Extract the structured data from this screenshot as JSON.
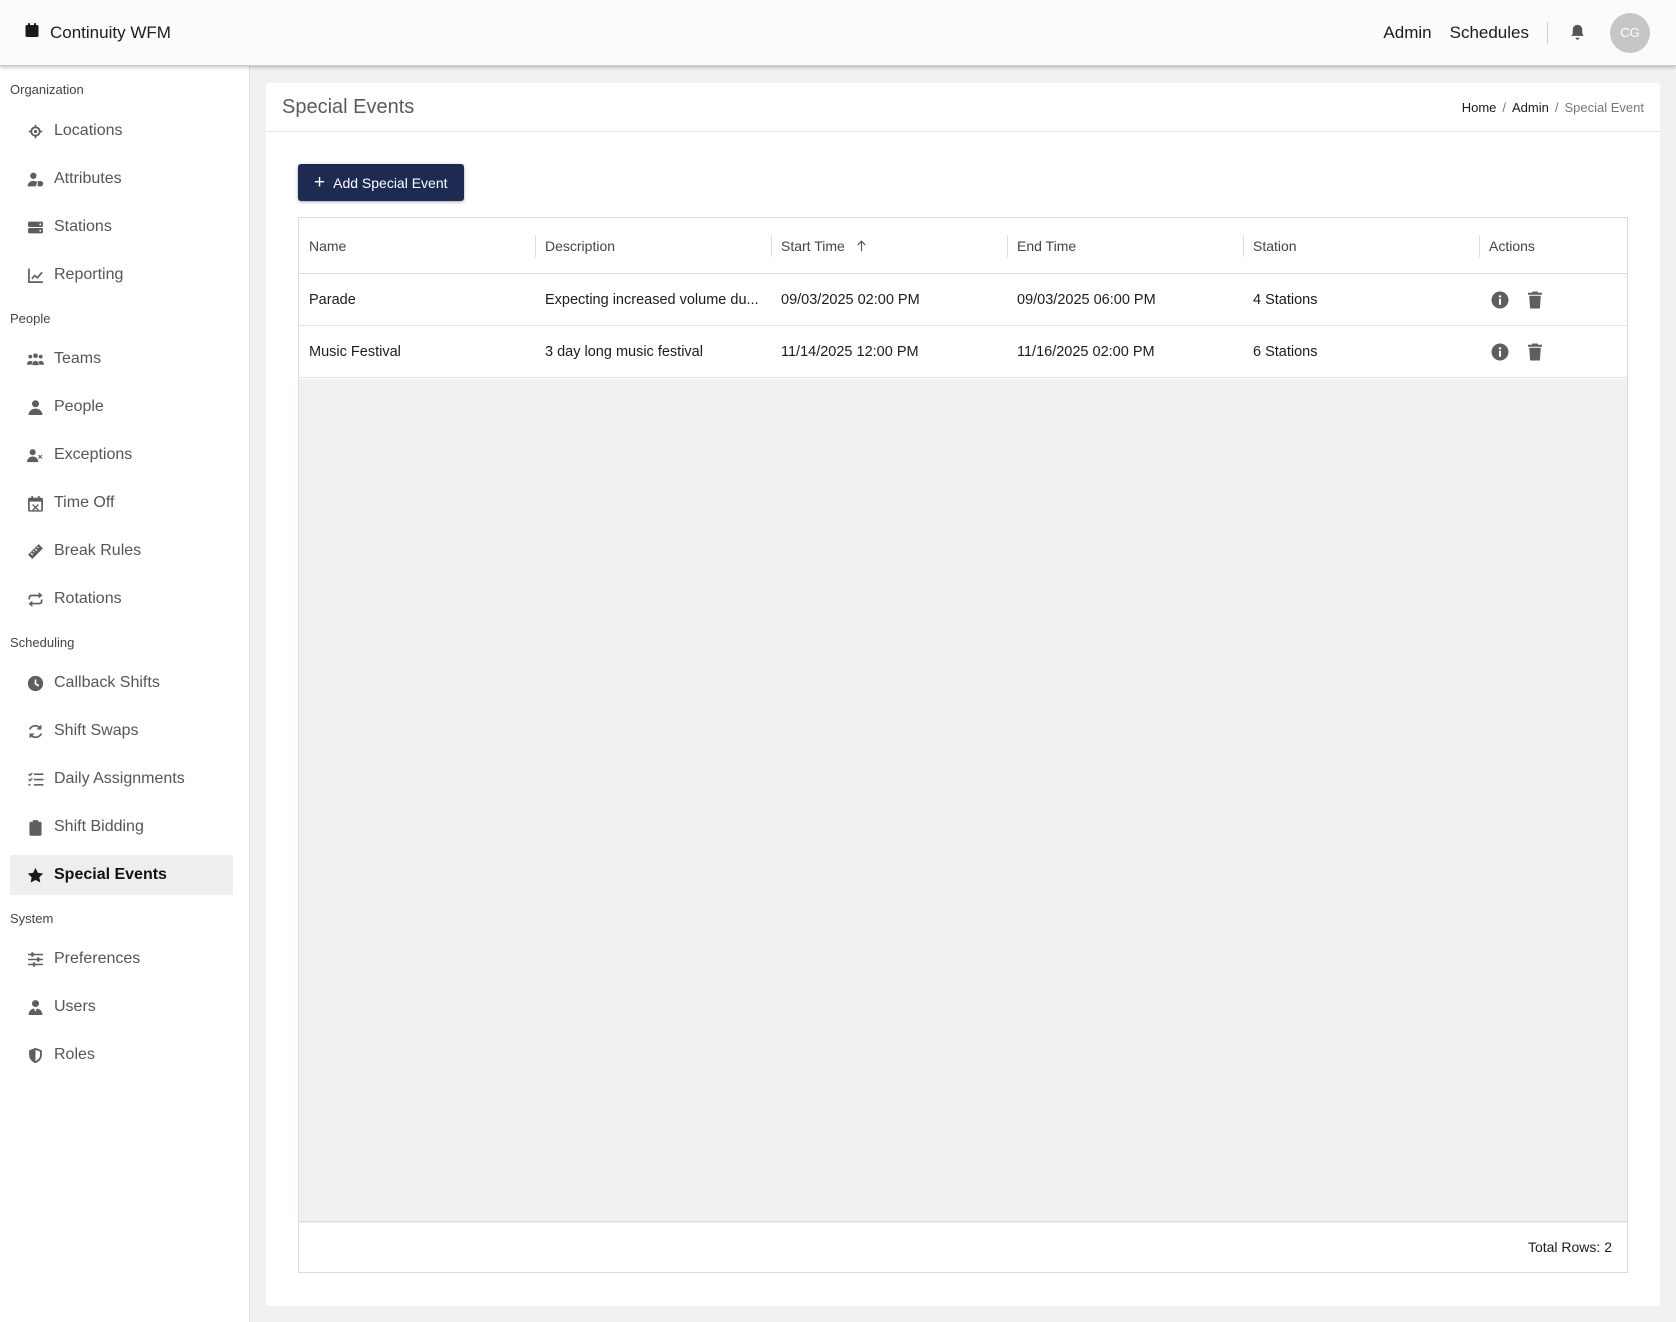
{
  "app": {
    "title": "Continuity WFM"
  },
  "topnav": {
    "admin": "Admin",
    "schedules": "Schedules",
    "avatar_initials": "CG"
  },
  "sidebar": {
    "sections": {
      "organization": "Organization",
      "people": "People",
      "scheduling": "Scheduling",
      "system": "System"
    },
    "items": [
      {
        "label": "Locations",
        "icon": "crosshair-icon"
      },
      {
        "label": "Attributes",
        "icon": "user-tag-icon"
      },
      {
        "label": "Stations",
        "icon": "server-icon"
      },
      {
        "label": "Reporting",
        "icon": "chart-line-icon"
      },
      {
        "label": "Teams",
        "icon": "users-icon"
      },
      {
        "label": "People",
        "icon": "user-icon"
      },
      {
        "label": "Exceptions",
        "icon": "user-x-icon"
      },
      {
        "label": "Time Off",
        "icon": "calendar-x-icon"
      },
      {
        "label": "Break Rules",
        "icon": "ruler-icon"
      },
      {
        "label": "Rotations",
        "icon": "repeat-icon"
      },
      {
        "label": "Callback Shifts",
        "icon": "clock-icon"
      },
      {
        "label": "Shift Swaps",
        "icon": "refresh-icon"
      },
      {
        "label": "Daily Assignments",
        "icon": "checklist-icon"
      },
      {
        "label": "Shift Bidding",
        "icon": "clipboard-icon"
      },
      {
        "label": "Special Events",
        "icon": "star-icon"
      },
      {
        "label": "Preferences",
        "icon": "sliders-icon"
      },
      {
        "label": "Users",
        "icon": "user-tie-icon"
      },
      {
        "label": "Roles",
        "icon": "shield-icon"
      }
    ],
    "active": "Special Events"
  },
  "page": {
    "title": "Special Events",
    "breadcrumb": {
      "home": "Home",
      "admin": "Admin",
      "current": "Special Event"
    },
    "add_button": "Add Special Event"
  },
  "table": {
    "columns": [
      "Name",
      "Description",
      "Start Time",
      "End Time",
      "Station",
      "Actions"
    ],
    "sorted_column": "Start Time",
    "sort_direction": "ascending",
    "rows": [
      {
        "name": "Parade",
        "description": "Expecting increased volume du...",
        "start": "09/03/2025 02:00 PM",
        "end": "09/03/2025 06:00 PM",
        "station": "4 Stations"
      },
      {
        "name": "Music Festival",
        "description": "3 day long music festival",
        "start": "11/14/2025 12:00 PM",
        "end": "11/16/2025 02:00 PM",
        "station": "6 Stations"
      }
    ],
    "footer": "Total Rows: 2"
  },
  "colors": {
    "primary_button": "#1d2a52",
    "active_nav_bg": "#eeeeee",
    "empty_grid_bg": "#f1f0ef"
  }
}
